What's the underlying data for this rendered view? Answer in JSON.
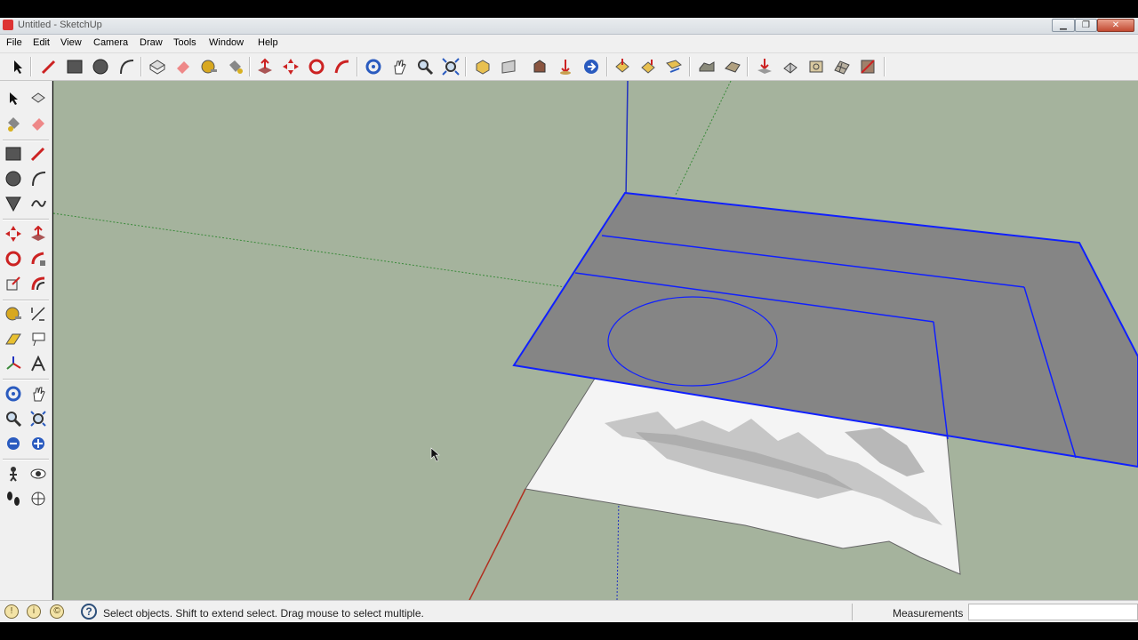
{
  "window": {
    "title": "Untitled - SketchUp",
    "controls": [
      "minimize",
      "maximize",
      "close"
    ]
  },
  "menu": {
    "items": [
      {
        "label": "File"
      },
      {
        "label": "Edit"
      },
      {
        "label": "View"
      },
      {
        "label": "Camera"
      },
      {
        "label": "Draw"
      },
      {
        "label": "Tools"
      },
      {
        "label": "Window"
      },
      {
        "label": "Help"
      }
    ]
  },
  "toolbar": {
    "tools": [
      "select-icon",
      "line-icon",
      "rectangle-icon",
      "circle-icon",
      "arc-icon",
      "make-component-icon",
      "eraser-icon",
      "tape-measure-icon",
      "paint-bucket-icon",
      "push-pull-icon",
      "move-icon",
      "rotate-icon",
      "follow-me-icon",
      "orbit-icon",
      "pan-icon",
      "zoom-icon",
      "zoom-extents-icon",
      "iso-view-icon",
      "top-view-icon",
      "front-view-icon",
      "right-view-icon",
      "back-view-icon",
      "left-view-icon",
      "sandbox-from-contours-icon",
      "sandbox-from-scratch-icon",
      "smoove-icon",
      "stamp-icon",
      "drape-icon",
      "add-detail-icon",
      "flip-edge-icon"
    ]
  },
  "palette": {
    "tools": [
      "select-icon",
      "make-component-icon",
      "paint-bucket-icon",
      "eraser-icon",
      "rectangle-icon",
      "line-icon",
      "circle-icon",
      "arc-icon",
      "polygon-icon",
      "freehand-icon",
      "move-icon",
      "push-pull-icon",
      "rotate-icon",
      "follow-me-icon",
      "scale-icon",
      "offset-icon",
      "tape-measure-icon",
      "dimension-icon",
      "protractor-icon",
      "text-icon",
      "axes-icon",
      "3d-text-icon",
      "orbit-icon",
      "pan-icon",
      "zoom-icon",
      "zoom-window-icon",
      "previous-view-icon",
      "zoom-extents-icon",
      "position-camera-icon",
      "look-around-icon",
      "walk-icon",
      "section-plane-icon"
    ]
  },
  "status": {
    "message": "Select objects. Shift to extend select. Drag mouse to select multiple.",
    "measurements_label": "Measurements",
    "measurements_value": ""
  },
  "colors": {
    "viewport_bg": "#a5b39d",
    "selection": "#1020ff",
    "face_gray": "#858585",
    "axis_red": "#b03020",
    "axis_green": "#3a8a3a",
    "axis_blue": "#2030c0"
  }
}
